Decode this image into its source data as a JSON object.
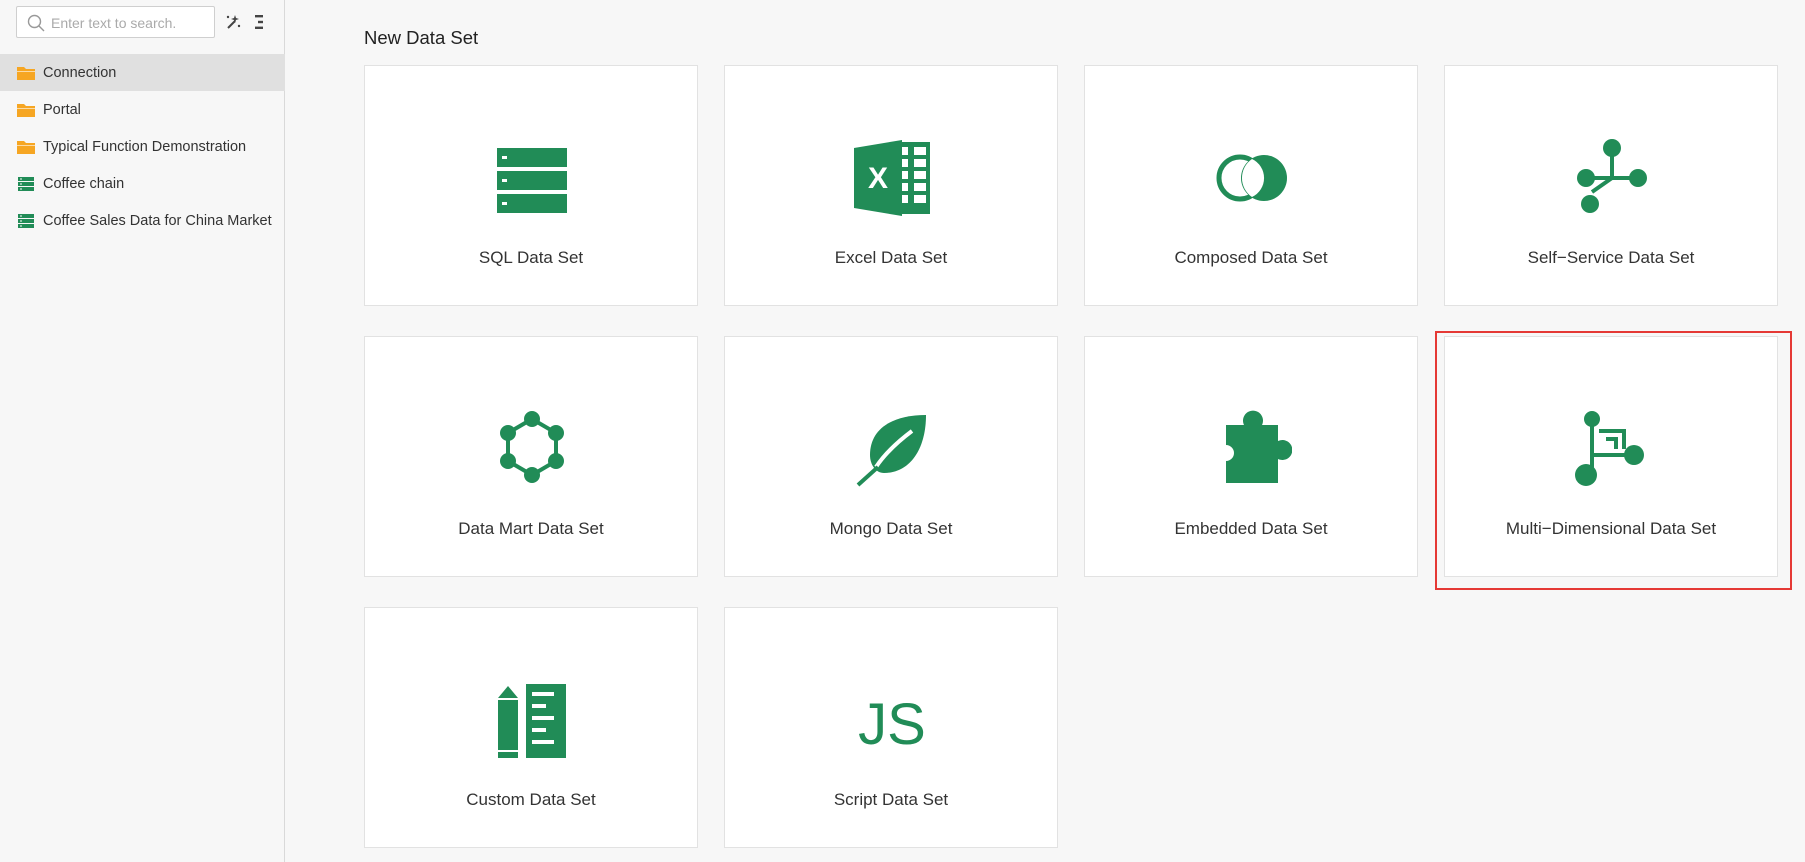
{
  "sidebar": {
    "search": {
      "placeholder": "Enter text to search."
    },
    "tree": [
      {
        "label": "Connection",
        "icon": "folder-icon",
        "selected": true
      },
      {
        "label": "Portal",
        "icon": "folder-icon"
      },
      {
        "label": "Typical Function Demonstration",
        "icon": "folder-icon"
      },
      {
        "label": "Coffee chain",
        "icon": "database-icon"
      },
      {
        "label": "Coffee Sales Data for China Market",
        "icon": "database-icon"
      }
    ]
  },
  "main": {
    "title": "New Data Set",
    "cards": [
      {
        "label": "SQL Data Set",
        "icon": "sql-data-set-icon"
      },
      {
        "label": "Excel Data Set",
        "icon": "excel-data-set-icon"
      },
      {
        "label": "Composed Data Set",
        "icon": "composed-data-set-icon"
      },
      {
        "label": "Self−Service Data Set",
        "icon": "self-service-data-set-icon"
      },
      {
        "label": "Data Mart Data Set",
        "icon": "data-mart-data-set-icon"
      },
      {
        "label": "Mongo Data Set",
        "icon": "mongo-data-set-icon"
      },
      {
        "label": "Embedded Data Set",
        "icon": "embedded-data-set-icon"
      },
      {
        "label": "Multi−Dimensional Data Set",
        "icon": "multi-dimensional-data-set-icon",
        "highlighted": true
      },
      {
        "label": "Custom Data Set",
        "icon": "custom-data-set-icon"
      },
      {
        "label": "Script Data Set",
        "icon": "script-data-set-icon",
        "icon_text": "JS"
      }
    ]
  },
  "colors": {
    "icon_green": "#218c57",
    "folder_orange": "#f6a623",
    "highlight_red": "#e53935"
  }
}
